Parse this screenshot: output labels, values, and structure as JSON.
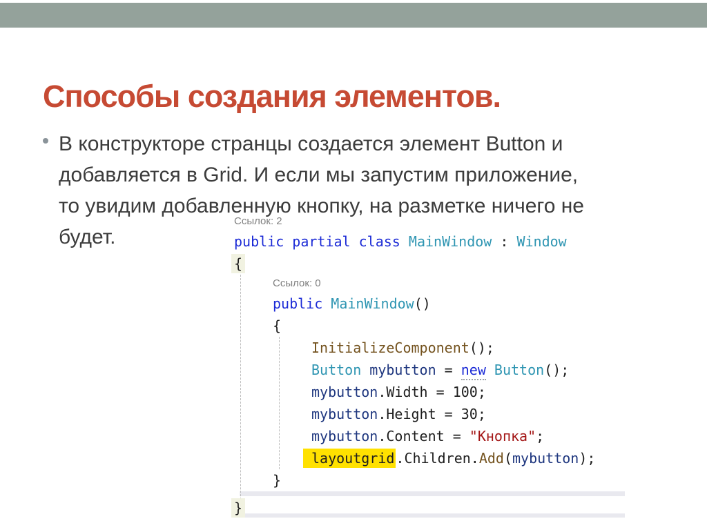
{
  "slide": {
    "title": "Способы создания элементов.",
    "bullet_marker": "•",
    "bullet_lines": [
      "В конструкторе странцы создается элемент Button и",
      "добавляется в Grid. И если мы запустим приложение,",
      "то увидим добавленную кнопку, на разметке ничего не",
      "будет."
    ]
  },
  "colors": {
    "top_bar": "#94A29B",
    "title": "#C64A33",
    "body_text": "#3C3C3C",
    "keyword_blue": "#1B2AD6",
    "type_teal": "#2E95B2",
    "variable_navy": "#1F377F",
    "method_brown": "#74531F",
    "string_red": "#A31515",
    "codelens_gray": "#7F7F7F",
    "highlight_yellow": "#FFE100"
  },
  "code": {
    "lines": [
      {
        "type": "lens",
        "indent": 0,
        "text": "Ссылок: 2"
      },
      {
        "type": "code",
        "indent": 0,
        "tokens": [
          {
            "t": "public",
            "c": "k"
          },
          {
            "t": " ",
            "c": "p"
          },
          {
            "t": "partial",
            "c": "k"
          },
          {
            "t": " ",
            "c": "p"
          },
          {
            "t": "class",
            "c": "k"
          },
          {
            "t": " ",
            "c": "p"
          },
          {
            "t": "MainWindow",
            "c": "t"
          },
          {
            "t": " : ",
            "c": "p"
          },
          {
            "t": "Window",
            "c": "t"
          }
        ]
      },
      {
        "type": "code",
        "indent": 0,
        "tokens": [
          {
            "t": "{",
            "c": "p",
            "box": true
          }
        ]
      },
      {
        "type": "lens",
        "indent": 1,
        "text": "Ссылок: 0"
      },
      {
        "type": "code",
        "indent": 1,
        "tokens": [
          {
            "t": "public",
            "c": "k"
          },
          {
            "t": " ",
            "c": "p"
          },
          {
            "t": "MainWindow",
            "c": "t"
          },
          {
            "t": "()",
            "c": "p"
          }
        ]
      },
      {
        "type": "code",
        "indent": 1,
        "tokens": [
          {
            "t": "{",
            "c": "p"
          }
        ]
      },
      {
        "type": "code",
        "indent": 2,
        "tokens": [
          {
            "t": "InitializeComponent",
            "c": "m"
          },
          {
            "t": "();",
            "c": "p"
          }
        ]
      },
      {
        "type": "code",
        "indent": 2,
        "tokens": [
          {
            "t": "Button",
            "c": "t"
          },
          {
            "t": " ",
            "c": "p"
          },
          {
            "t": "mybutton",
            "c": "v"
          },
          {
            "t": " = ",
            "c": "p"
          },
          {
            "t": "new",
            "c": "k",
            "u": true
          },
          {
            "t": " ",
            "c": "p"
          },
          {
            "t": "Button",
            "c": "t"
          },
          {
            "t": "();",
            "c": "p"
          }
        ]
      },
      {
        "type": "code",
        "indent": 2,
        "tokens": [
          {
            "t": "mybutton",
            "c": "v"
          },
          {
            "t": ".Width = 100;",
            "c": "p"
          }
        ]
      },
      {
        "type": "code",
        "indent": 2,
        "tokens": [
          {
            "t": "mybutton",
            "c": "v"
          },
          {
            "t": ".Height = 30;",
            "c": "p"
          }
        ]
      },
      {
        "type": "code",
        "indent": 2,
        "tokens": [
          {
            "t": "mybutton",
            "c": "v"
          },
          {
            "t": ".Content = ",
            "c": "p"
          },
          {
            "t": "\"Кнопка\"",
            "c": "s"
          },
          {
            "t": ";",
            "c": "p"
          }
        ]
      },
      {
        "type": "code",
        "indent": 2,
        "tokens": [
          {
            "t": "layoutgrid",
            "c": "p",
            "hl": true
          },
          {
            "t": ".Children.",
            "c": "p"
          },
          {
            "t": "Add",
            "c": "m"
          },
          {
            "t": "(",
            "c": "p"
          },
          {
            "t": "mybutton",
            "c": "v"
          },
          {
            "t": ");",
            "c": "p"
          }
        ]
      },
      {
        "type": "code",
        "indent": 1,
        "tokens": [
          {
            "t": "}",
            "c": "p"
          }
        ]
      },
      {
        "type": "code",
        "indent": 0,
        "last": true,
        "tokens": [
          {
            "t": "}",
            "c": "p",
            "box": true
          }
        ]
      }
    ]
  }
}
